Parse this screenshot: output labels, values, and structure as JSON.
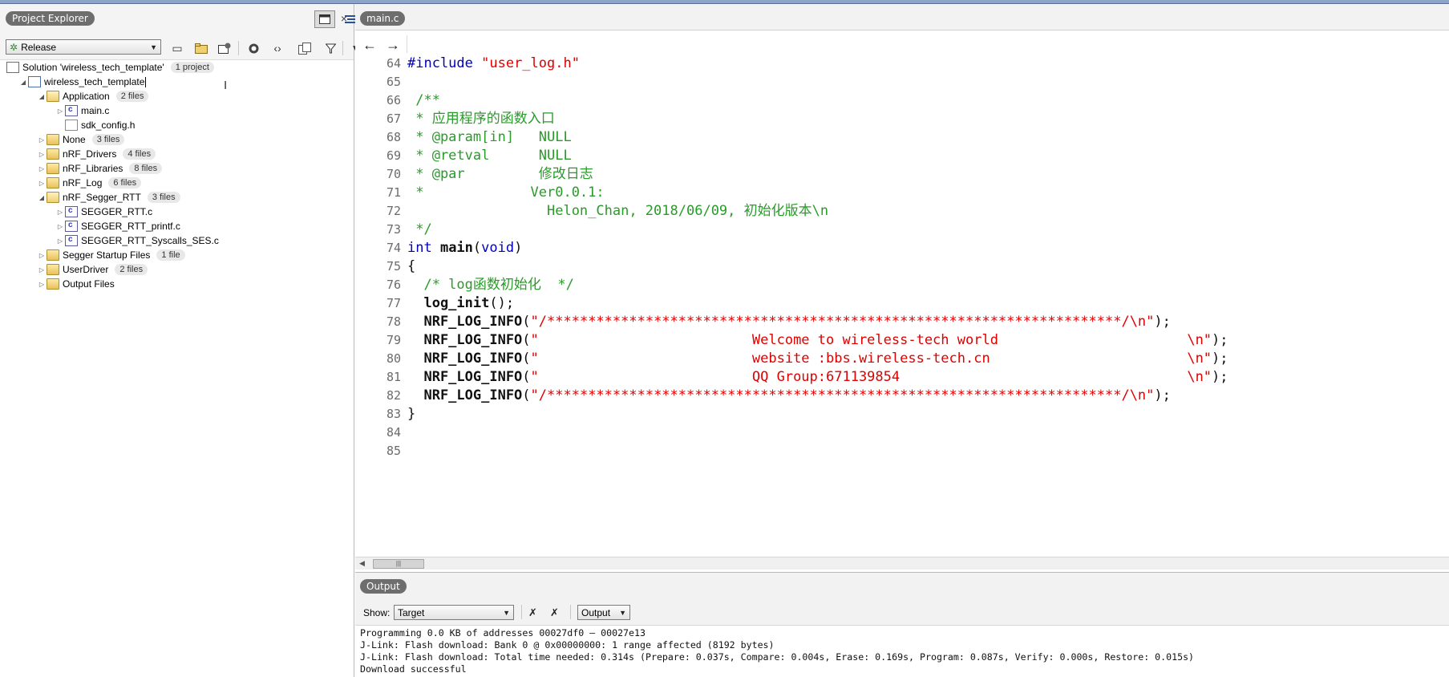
{
  "project_explorer": {
    "title": "Project Explorer",
    "configuration": "Release",
    "close_glyph": "×",
    "tree": [
      {
        "label": "Solution 'wireless_tech_template'",
        "badge": "1 project",
        "icon": "solution-icon",
        "depth": 0,
        "toggle": ""
      },
      {
        "label": "wireless_tech_template",
        "badge": "",
        "icon": "project-icon",
        "depth": 1,
        "toggle": "◢",
        "selected": true
      },
      {
        "label": "Application",
        "badge": "2 files",
        "icon": "folder-open-icon",
        "depth": 2,
        "toggle": "◢"
      },
      {
        "label": "main.c",
        "badge": "",
        "icon": "c-file-icon",
        "depth": 3,
        "toggle": "▷"
      },
      {
        "label": "sdk_config.h",
        "badge": "",
        "icon": "h-file-icon",
        "depth": 3,
        "toggle": ""
      },
      {
        "label": "None",
        "badge": "3 files",
        "icon": "folder-icon",
        "depth": 2,
        "toggle": "▷"
      },
      {
        "label": "nRF_Drivers",
        "badge": "4 files",
        "icon": "folder-icon",
        "depth": 2,
        "toggle": "▷"
      },
      {
        "label": "nRF_Libraries",
        "badge": "8 files",
        "icon": "folder-icon",
        "depth": 2,
        "toggle": "▷"
      },
      {
        "label": "nRF_Log",
        "badge": "6 files",
        "icon": "folder-icon",
        "depth": 2,
        "toggle": "▷"
      },
      {
        "label": "nRF_Segger_RTT",
        "badge": "3 files",
        "icon": "folder-open-icon",
        "depth": 2,
        "toggle": "◢"
      },
      {
        "label": "SEGGER_RTT.c",
        "badge": "",
        "icon": "c-file-icon",
        "depth": 3,
        "toggle": "▷"
      },
      {
        "label": "SEGGER_RTT_printf.c",
        "badge": "",
        "icon": "c-file-icon",
        "depth": 3,
        "toggle": "▷"
      },
      {
        "label": "SEGGER_RTT_Syscalls_SES.c",
        "badge": "",
        "icon": "c-file-icon",
        "depth": 3,
        "toggle": "▷"
      },
      {
        "label": "Segger Startup Files",
        "badge": "1 file",
        "icon": "folder-icon",
        "depth": 2,
        "toggle": "▷"
      },
      {
        "label": "UserDriver",
        "badge": "2 files",
        "icon": "folder-icon",
        "depth": 2,
        "toggle": "▷"
      },
      {
        "label": "Output Files",
        "badge": "",
        "icon": "folder-icon",
        "depth": 2,
        "toggle": "▷"
      }
    ]
  },
  "editor": {
    "tab_label": "main.c",
    "back_glyph": "🡐",
    "forward_glyph": "🡒",
    "lines": [
      {
        "n": "64",
        "parts": [
          [
            "kw",
            "#include "
          ],
          [
            "str",
            "\"user_log.h\""
          ]
        ]
      },
      {
        "n": "65",
        "parts": []
      },
      {
        "n": "66",
        "parts": [
          [
            "cm",
            " /**"
          ]
        ]
      },
      {
        "n": "67",
        "parts": [
          [
            "cm",
            " * 应用程序的函数入口"
          ]
        ]
      },
      {
        "n": "68",
        "parts": [
          [
            "cm",
            " * @param[in]   NULL"
          ]
        ]
      },
      {
        "n": "69",
        "parts": [
          [
            "cm",
            " * @retval      NULL"
          ]
        ]
      },
      {
        "n": "70",
        "parts": [
          [
            "cm",
            " * @par         修改日志"
          ]
        ]
      },
      {
        "n": "71",
        "parts": [
          [
            "cm",
            " *             Ver0.0.1:"
          ]
        ]
      },
      {
        "n": "72",
        "parts": [
          [
            "cm",
            "                 Helon_Chan, 2018/06/09, 初始化版本\\n"
          ]
        ]
      },
      {
        "n": "73",
        "parts": [
          [
            "cm",
            " */"
          ]
        ]
      },
      {
        "n": "74",
        "parts": [
          [
            "kw",
            "int "
          ],
          [
            "fn",
            "main"
          ],
          [
            "plain",
            "("
          ],
          [
            "kw",
            "void"
          ],
          [
            "plain",
            ")"
          ]
        ]
      },
      {
        "n": "75",
        "parts": [
          [
            "plain",
            "{"
          ]
        ]
      },
      {
        "n": "76",
        "parts": [
          [
            "cm",
            "  /* log函数初始化  */"
          ]
        ]
      },
      {
        "n": "77",
        "parts": [
          [
            "fn",
            "  log_init"
          ],
          [
            "plain",
            "();"
          ]
        ]
      },
      {
        "n": "78",
        "parts": [
          [
            "fn",
            "  NRF_LOG_INFO"
          ],
          [
            "plain",
            "("
          ],
          [
            "str",
            "\"/**********************************************************************/\\n\""
          ],
          [
            "plain",
            ");"
          ]
        ]
      },
      {
        "n": "79",
        "parts": [
          [
            "fn",
            "  NRF_LOG_INFO"
          ],
          [
            "plain",
            "("
          ],
          [
            "str",
            "\"                          Welcome to wireless-tech world                       \\n\""
          ],
          [
            "plain",
            ");"
          ]
        ]
      },
      {
        "n": "80",
        "parts": [
          [
            "fn",
            "  NRF_LOG_INFO"
          ],
          [
            "plain",
            "("
          ],
          [
            "str",
            "\"                          website :bbs.wireless-tech.cn                        \\n\""
          ],
          [
            "plain",
            ");"
          ]
        ]
      },
      {
        "n": "81",
        "parts": [
          [
            "fn",
            "  NRF_LOG_INFO"
          ],
          [
            "plain",
            "("
          ],
          [
            "str",
            "\"                          QQ Group:671139854                                   \\n\""
          ],
          [
            "plain",
            ");"
          ]
        ]
      },
      {
        "n": "82",
        "parts": [
          [
            "fn",
            "  NRF_LOG_INFO"
          ],
          [
            "plain",
            "("
          ],
          [
            "str",
            "\"/**********************************************************************/\\n\""
          ],
          [
            "plain",
            ");"
          ]
        ]
      },
      {
        "n": "83",
        "parts": [
          [
            "plain",
            "}"
          ]
        ]
      },
      {
        "n": "84",
        "parts": []
      },
      {
        "n": "85",
        "parts": []
      }
    ]
  },
  "output": {
    "title": "Output",
    "show_label": "Show:",
    "show_value": "Target",
    "mode_value": "Output",
    "log": [
      "Programming 0.0 KB of addresses 00027df0 — 00027e13",
      "J-Link: Flash download: Bank 0 @ 0x00000000: 1 range affected (8192 bytes)",
      "J-Link: Flash download: Total time needed: 0.314s (Prepare: 0.037s, Compare: 0.004s, Erase: 0.169s, Program: 0.087s, Verify: 0.000s, Restore: 0.015s)",
      "Download successful"
    ]
  },
  "colors": {
    "keyword": "#0000c0",
    "string": "#e00000",
    "comment": "#2a9a2a",
    "pill_bg": "#6e6e6e"
  }
}
